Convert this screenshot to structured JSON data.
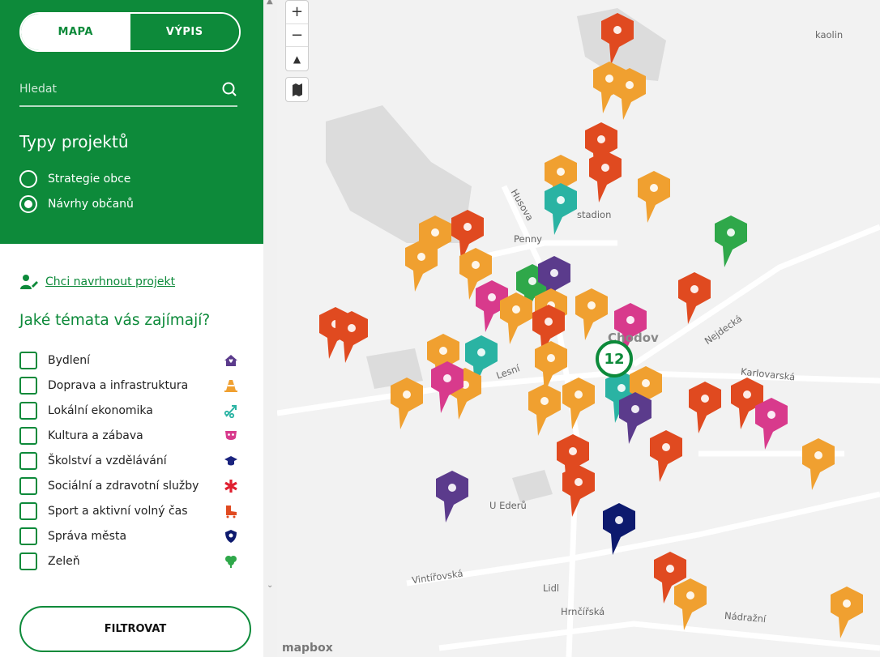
{
  "tabs": {
    "map": "MAPA",
    "list": "VÝPIS"
  },
  "search": {
    "placeholder": "Hledat"
  },
  "types": {
    "title": "Typy projektů",
    "options": [
      {
        "label": "Strategie obce",
        "checked": false
      },
      {
        "label": "Návrhy občanů",
        "checked": true
      }
    ]
  },
  "propose_link": "Chci navrhnout projekt",
  "topics": {
    "title": "Jaké témata vás zajímají?",
    "items": [
      {
        "label": "Bydlení",
        "icon": "home-icon",
        "color": "#5b3b8c"
      },
      {
        "label": "Doprava a infrastruktura",
        "icon": "traffic-cone-icon",
        "color": "#f0a030"
      },
      {
        "label": "Lokální ekonomika",
        "icon": "percent-arrow-icon",
        "color": "#2ab3a3"
      },
      {
        "label": "Kultura a zábava",
        "icon": "theater-mask-icon",
        "color": "#d83a8c"
      },
      {
        "label": "Školství a vzdělávání",
        "icon": "graduation-cap-icon",
        "color": "#1a237e"
      },
      {
        "label": "Sociální a zdravotní služby",
        "icon": "asterisk-icon",
        "color": "#e02030"
      },
      {
        "label": "Sport a aktivní volný čas",
        "icon": "roller-skate-icon",
        "color": "#e04a20"
      },
      {
        "label": "Správa města",
        "icon": "shield-icon",
        "color": "#0d1a6e"
      },
      {
        "label": "Zeleň",
        "icon": "tree-icon",
        "color": "#2fa84a"
      }
    ]
  },
  "filter_button": "FILTROVAT",
  "map": {
    "labels": [
      "kaolin",
      "Husova",
      "Penny",
      "Nejdecká",
      "Karlovarská",
      "Lesní",
      "U Ederů",
      "Vintířovská",
      "Lidl",
      "Hrnčířská",
      "Nádražní",
      "stadion",
      "Chodov"
    ],
    "cluster_count": "12",
    "attribution": "mapbox"
  },
  "colors": {
    "brand_green": "#0d8a3a",
    "pin_orange": "#f0a030",
    "pin_red": "#e04a20",
    "pin_purple": "#5b3b8c",
    "pin_teal": "#2ab3a3",
    "pin_pink": "#d83a8c",
    "pin_navy": "#0d1a6e",
    "pin_green": "#2fa84a"
  }
}
